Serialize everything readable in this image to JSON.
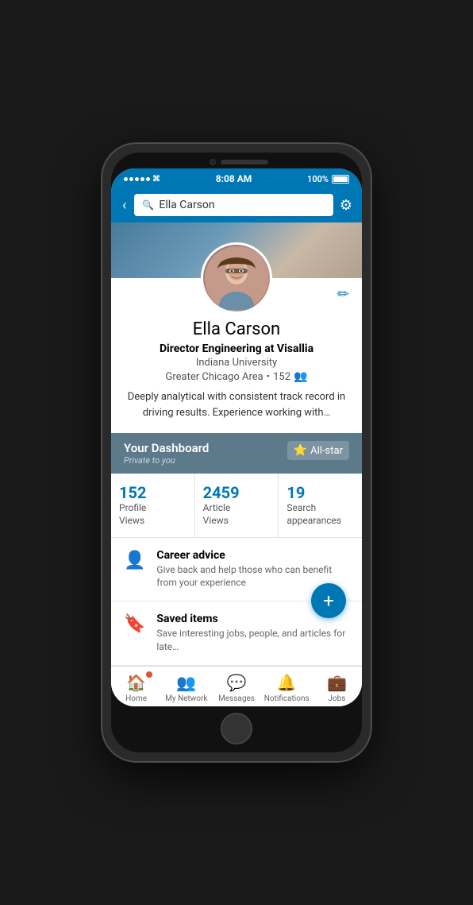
{
  "status_bar": {
    "time": "8:08 AM",
    "battery": "100%"
  },
  "top_bar": {
    "back_label": "‹",
    "search_value": "Ella Carson",
    "search_placeholder": "Search"
  },
  "profile": {
    "name": "Ella Carson",
    "title": "Director Engineering at Visallia",
    "school": "Indiana University",
    "location": "Greater Chicago Area",
    "connections": "152",
    "bio": "Deeply analytical with consistent track record in driving results. Experience working with…"
  },
  "dashboard": {
    "title": "Your Dashboard",
    "subtitle": "Private to you",
    "all_star_label": "All-star"
  },
  "stats": [
    {
      "number": "152",
      "label": "Profile\nViews"
    },
    {
      "number": "2459",
      "label": "Article\nViews"
    },
    {
      "number": "19",
      "label": "Search\nappearances"
    }
  ],
  "list_items": [
    {
      "title": "Career advice",
      "desc": "Give back and help those who can benefit from your experience"
    },
    {
      "title": "Saved items",
      "desc": "Save interesting jobs, people, and articles for late…"
    }
  ],
  "nav": [
    {
      "icon": "🏠",
      "label": "Home",
      "badge": true
    },
    {
      "icon": "👥",
      "label": "My Network",
      "badge": false
    },
    {
      "icon": "💬",
      "label": "Messages",
      "badge": false
    },
    {
      "icon": "🔔",
      "label": "Notifications",
      "badge": false
    },
    {
      "icon": "💼",
      "label": "Jobs",
      "badge": false
    }
  ],
  "fab_label": "+"
}
